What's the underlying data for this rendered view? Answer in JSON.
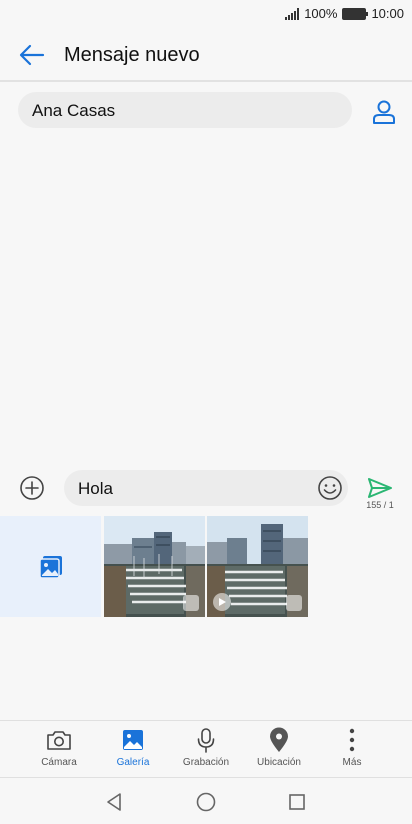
{
  "status": {
    "battery": "100%",
    "time": "10:00"
  },
  "header": {
    "title": "Mensaje nuevo"
  },
  "recipient": {
    "name": "Ana Casas"
  },
  "compose": {
    "text": "Hola",
    "counter": "155 / 1"
  },
  "tabs": [
    {
      "label": "Cámara",
      "icon": "camera-icon",
      "active": false
    },
    {
      "label": "Galería",
      "icon": "gallery-icon",
      "active": true
    },
    {
      "label": "Grabación",
      "icon": "microphone-icon",
      "active": false
    },
    {
      "label": "Ubicación",
      "icon": "location-icon",
      "active": false
    },
    {
      "label": "Más",
      "icon": "more-icon",
      "active": false
    }
  ],
  "colors": {
    "accent": "#1a73d9",
    "send": "#2bb673"
  }
}
